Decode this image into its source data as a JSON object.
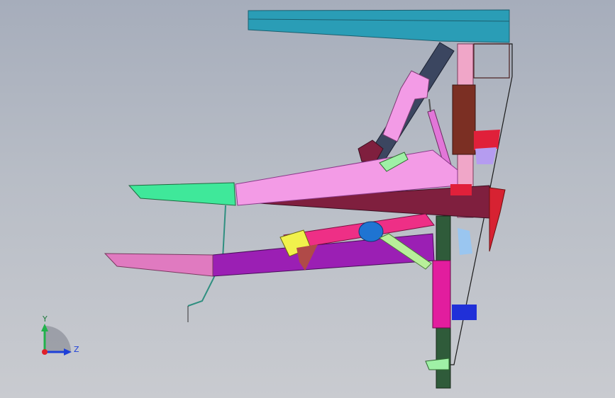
{
  "viewport": {
    "background_top": "#a6adbb",
    "background_bottom": "#c9cbd0"
  },
  "triad": {
    "y_label": "Y",
    "z_label": "Z",
    "y_color": "#22b24c",
    "z_color": "#1e3fd8",
    "origin_color": "#e0202a"
  },
  "parts": {
    "top_beam": "#2a9db6",
    "main_column": "#f0a6c8",
    "column_bracket": "#7b2f23",
    "upper_arm": "#f39be6",
    "upper_arm_tip": "#3fe89a",
    "middle_beam": "#7f1f3e",
    "diagonal_link": "#3b4660",
    "cylinder": "#e276d8",
    "lower_arm": "#9b1fb4",
    "lower_arm_tip": "#e07ac0",
    "link_bar": "#ee2f86",
    "link_strut": "#b8ef9a",
    "link_hub": "#1f74d2",
    "lower_column": "#e21d9e",
    "lower_column_base": "#2f5b3a",
    "red_block": "#e0203a",
    "blue_block": "#2030d8",
    "lilac_block": "#b59cf0",
    "yellow_bracket": "#f1f14c",
    "brown_wedge": "#b04a48",
    "green_foot": "#9ff0a6",
    "wire": "#2f8f80",
    "frame_outline": "#1a1a1a",
    "red_panel": "#d72232",
    "light_blue_block": "#9ac6f0"
  }
}
